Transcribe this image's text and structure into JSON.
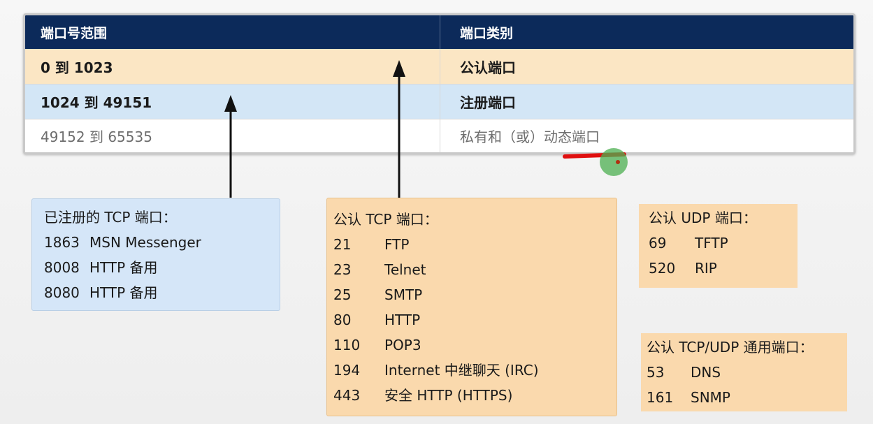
{
  "table": {
    "headers": [
      "端口号范围",
      "端口类别"
    ],
    "rows": [
      {
        "range": "0 到 1023",
        "category": "公认端口"
      },
      {
        "range": "1024 到 49151",
        "category": "注册端口"
      },
      {
        "range": "49152 到 65535",
        "category": "私有和（或）动态端口"
      }
    ]
  },
  "registered_tcp": {
    "title": "已注册的 TCP 端口：",
    "items": [
      {
        "port": "1863",
        "name": "MSN Messenger"
      },
      {
        "port": "8008",
        "name": "HTTP 备用"
      },
      {
        "port": "8080",
        "name": "HTTP 备用"
      }
    ]
  },
  "wellknown_tcp": {
    "title": "公认 TCP 端口：",
    "items": [
      {
        "port": "21",
        "name": "FTP"
      },
      {
        "port": "23",
        "name": "Telnet"
      },
      {
        "port": "25",
        "name": "SMTP"
      },
      {
        "port": "80",
        "name": "HTTP"
      },
      {
        "port": "110",
        "name": "POP3"
      },
      {
        "port": "194",
        "name": "Internet 中继聊天 (IRC)"
      },
      {
        "port": "443",
        "name": "安全 HTTP (HTTPS)"
      }
    ]
  },
  "wellknown_udp": {
    "title": "公认 UDP 端口：",
    "items": [
      {
        "port": "69",
        "name": "TFTP"
      },
      {
        "port": "520",
        "name": "RIP"
      }
    ]
  },
  "wellknown_tcp_udp": {
    "title": "公认 TCP/UDP 通用端口：",
    "items": [
      {
        "port": "53",
        "name": "DNS"
      },
      {
        "port": "161",
        "name": "SNMP"
      }
    ]
  },
  "colors": {
    "header_bg": "#0c2a5a",
    "wellknown_row": "#fbe6c4",
    "registered_row": "#d3e6f6",
    "annotation_red": "#e01010",
    "cursor_green": "#4caf50"
  }
}
